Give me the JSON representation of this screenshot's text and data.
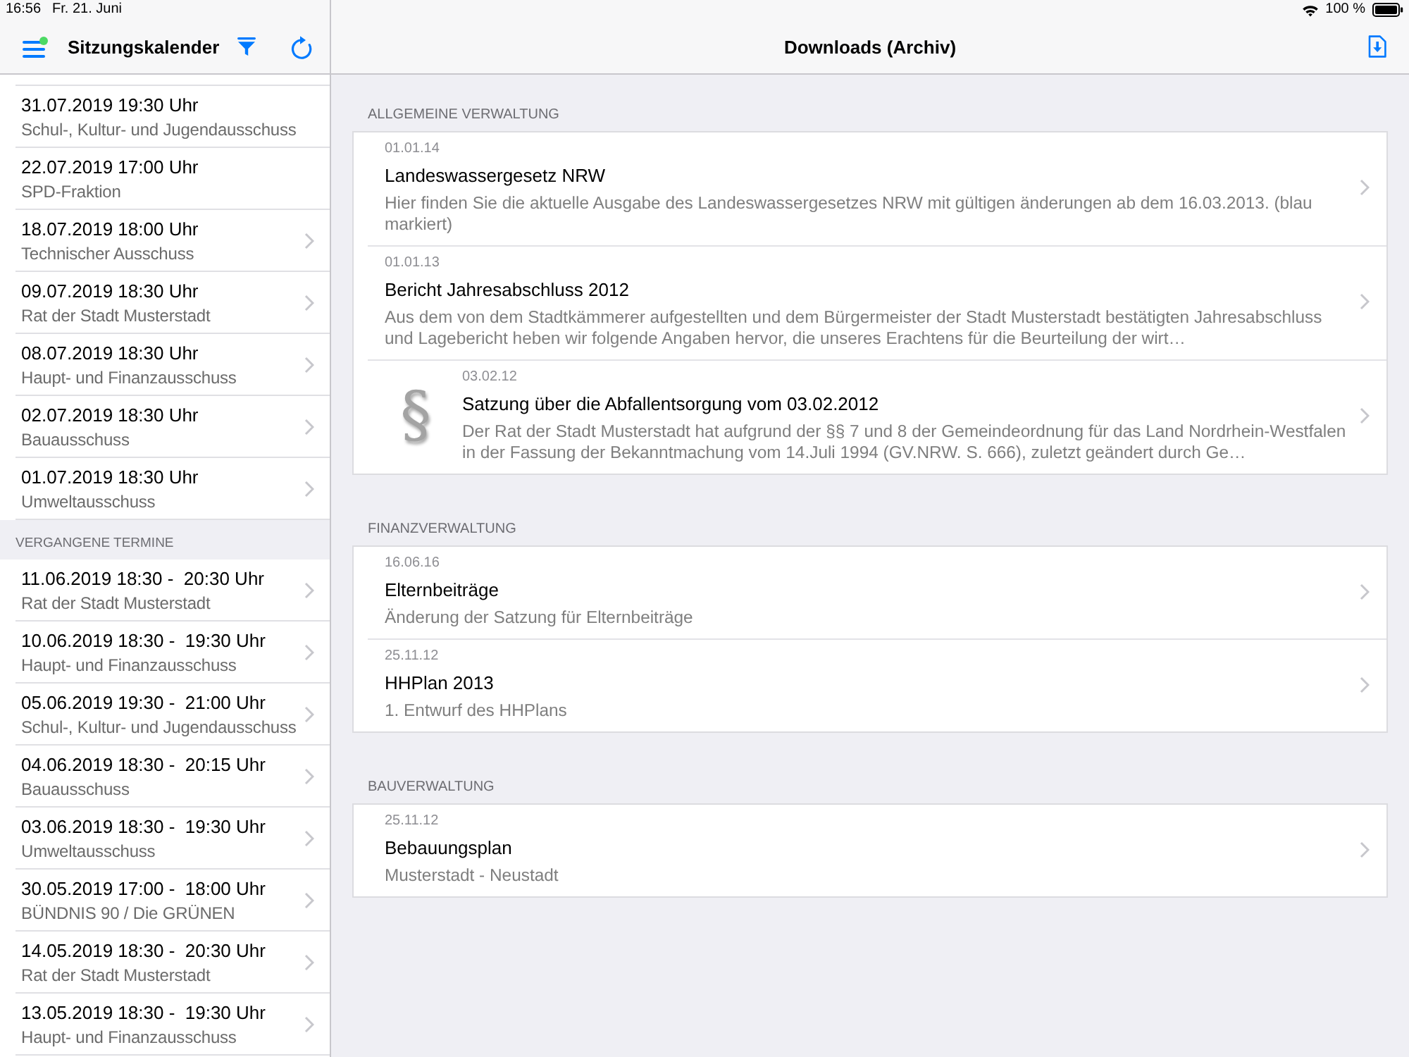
{
  "status_bar": {
    "time": "16:56",
    "date": "Fr. 21. Juni",
    "battery": "100 %"
  },
  "sidebar": {
    "title": "Sitzungskalender",
    "menu_badge": true,
    "upcoming": [
      {
        "when": "31.07.2019 19:30 Uhr",
        "committee": "Schul-, Kultur- und Jugendausschuss",
        "chevron": false
      },
      {
        "when": "22.07.2019 17:00 Uhr",
        "committee": "SPD-Fraktion",
        "chevron": false
      },
      {
        "when": "18.07.2019 18:00 Uhr",
        "committee": "Technischer Ausschuss",
        "chevron": true
      },
      {
        "when": "09.07.2019 18:30 Uhr",
        "committee": "Rat der Stadt Musterstadt",
        "chevron": true
      },
      {
        "when": "08.07.2019 18:30 Uhr",
        "committee": "Haupt- und Finanzausschuss",
        "chevron": true
      },
      {
        "when": "02.07.2019 18:30 Uhr",
        "committee": "Bauausschuss",
        "chevron": true
      },
      {
        "when": "01.07.2019 18:30 Uhr",
        "committee": "Umweltausschuss",
        "chevron": true
      }
    ],
    "past": {
      "header": "VERGANGENE TERMINE",
      "items": [
        {
          "when": "11.06.2019 18:30 -  20:30 Uhr",
          "committee": "Rat der Stadt Musterstadt",
          "chevron": true
        },
        {
          "when": "10.06.2019 18:30 -  19:30 Uhr",
          "committee": "Haupt- und Finanzausschuss",
          "chevron": true
        },
        {
          "when": "05.06.2019 19:30 -  21:00 Uhr",
          "committee": "Schul-, Kultur- und Jugendausschuss",
          "chevron": true
        },
        {
          "when": "04.06.2019 18:30 -  20:15 Uhr",
          "committee": "Bauausschuss",
          "chevron": true
        },
        {
          "when": "03.06.2019 18:30 -  19:30 Uhr",
          "committee": "Umweltausschuss",
          "chevron": true
        },
        {
          "when": "30.05.2019 17:00 -  18:00 Uhr",
          "committee": "BÜNDNIS 90 / Die GRÜNEN",
          "chevron": true
        },
        {
          "when": "14.05.2019 18:30 -  20:30 Uhr",
          "committee": "Rat der Stadt Musterstadt",
          "chevron": true
        },
        {
          "when": "13.05.2019 18:30 -  19:30 Uhr",
          "committee": "Haupt- und Finanzausschuss",
          "chevron": true
        }
      ]
    }
  },
  "main": {
    "title": "Downloads (Archiv)",
    "sections": [
      {
        "header": "ALLGEMEINE VERWALTUNG",
        "items": [
          {
            "date": "01.01.14",
            "title": "Landeswassergesetz NRW",
            "description": "Hier finden Sie die aktuelle Ausgabe des Landeswassergesetzes NRW mit gültigen änderungen ab dem 16.03.2013. (blau markiert)"
          },
          {
            "date": "01.01.13",
            "title": "Bericht Jahresabschluss 2012",
            "description": "Aus dem von dem Stadtkämmerer aufgestellten und dem Bürgermeister der Stadt Musterstadt bestätigten Jahresabschluss und Lagebericht heben wir folgende Angaben hervor, die unseres Erachtens für die Beurteilung der wirt…"
          },
          {
            "date": "03.02.12",
            "title": "Satzung über die Abfallentsorgung vom 03.02.2012",
            "description": "Der Rat der Stadt Musterstadt hat aufgrund der §§ 7 und 8 der Gemeindeordnung für das Land Nordrhein-Westfalen in der Fassung der Bekanntmachung vom 14.Juli 1994 (GV.NRW. S. 666), zuletzt geändert durch Ge…",
            "thumbnail": "§"
          }
        ]
      },
      {
        "header": "FINANZVERWALTUNG",
        "items": [
          {
            "date": "16.06.16",
            "title": "Elternbeiträge",
            "description": "Änderung der Satzung für Elternbeiträge"
          },
          {
            "date": "25.11.12",
            "title": "HHPlan 2013",
            "description": "1. Entwurf des HHPlans"
          }
        ]
      },
      {
        "header": "BAUVERWALTUNG",
        "items": [
          {
            "date": "25.11.12",
            "title": "Bebauungsplan",
            "description": "Musterstadt - Neustadt"
          }
        ]
      }
    ]
  }
}
